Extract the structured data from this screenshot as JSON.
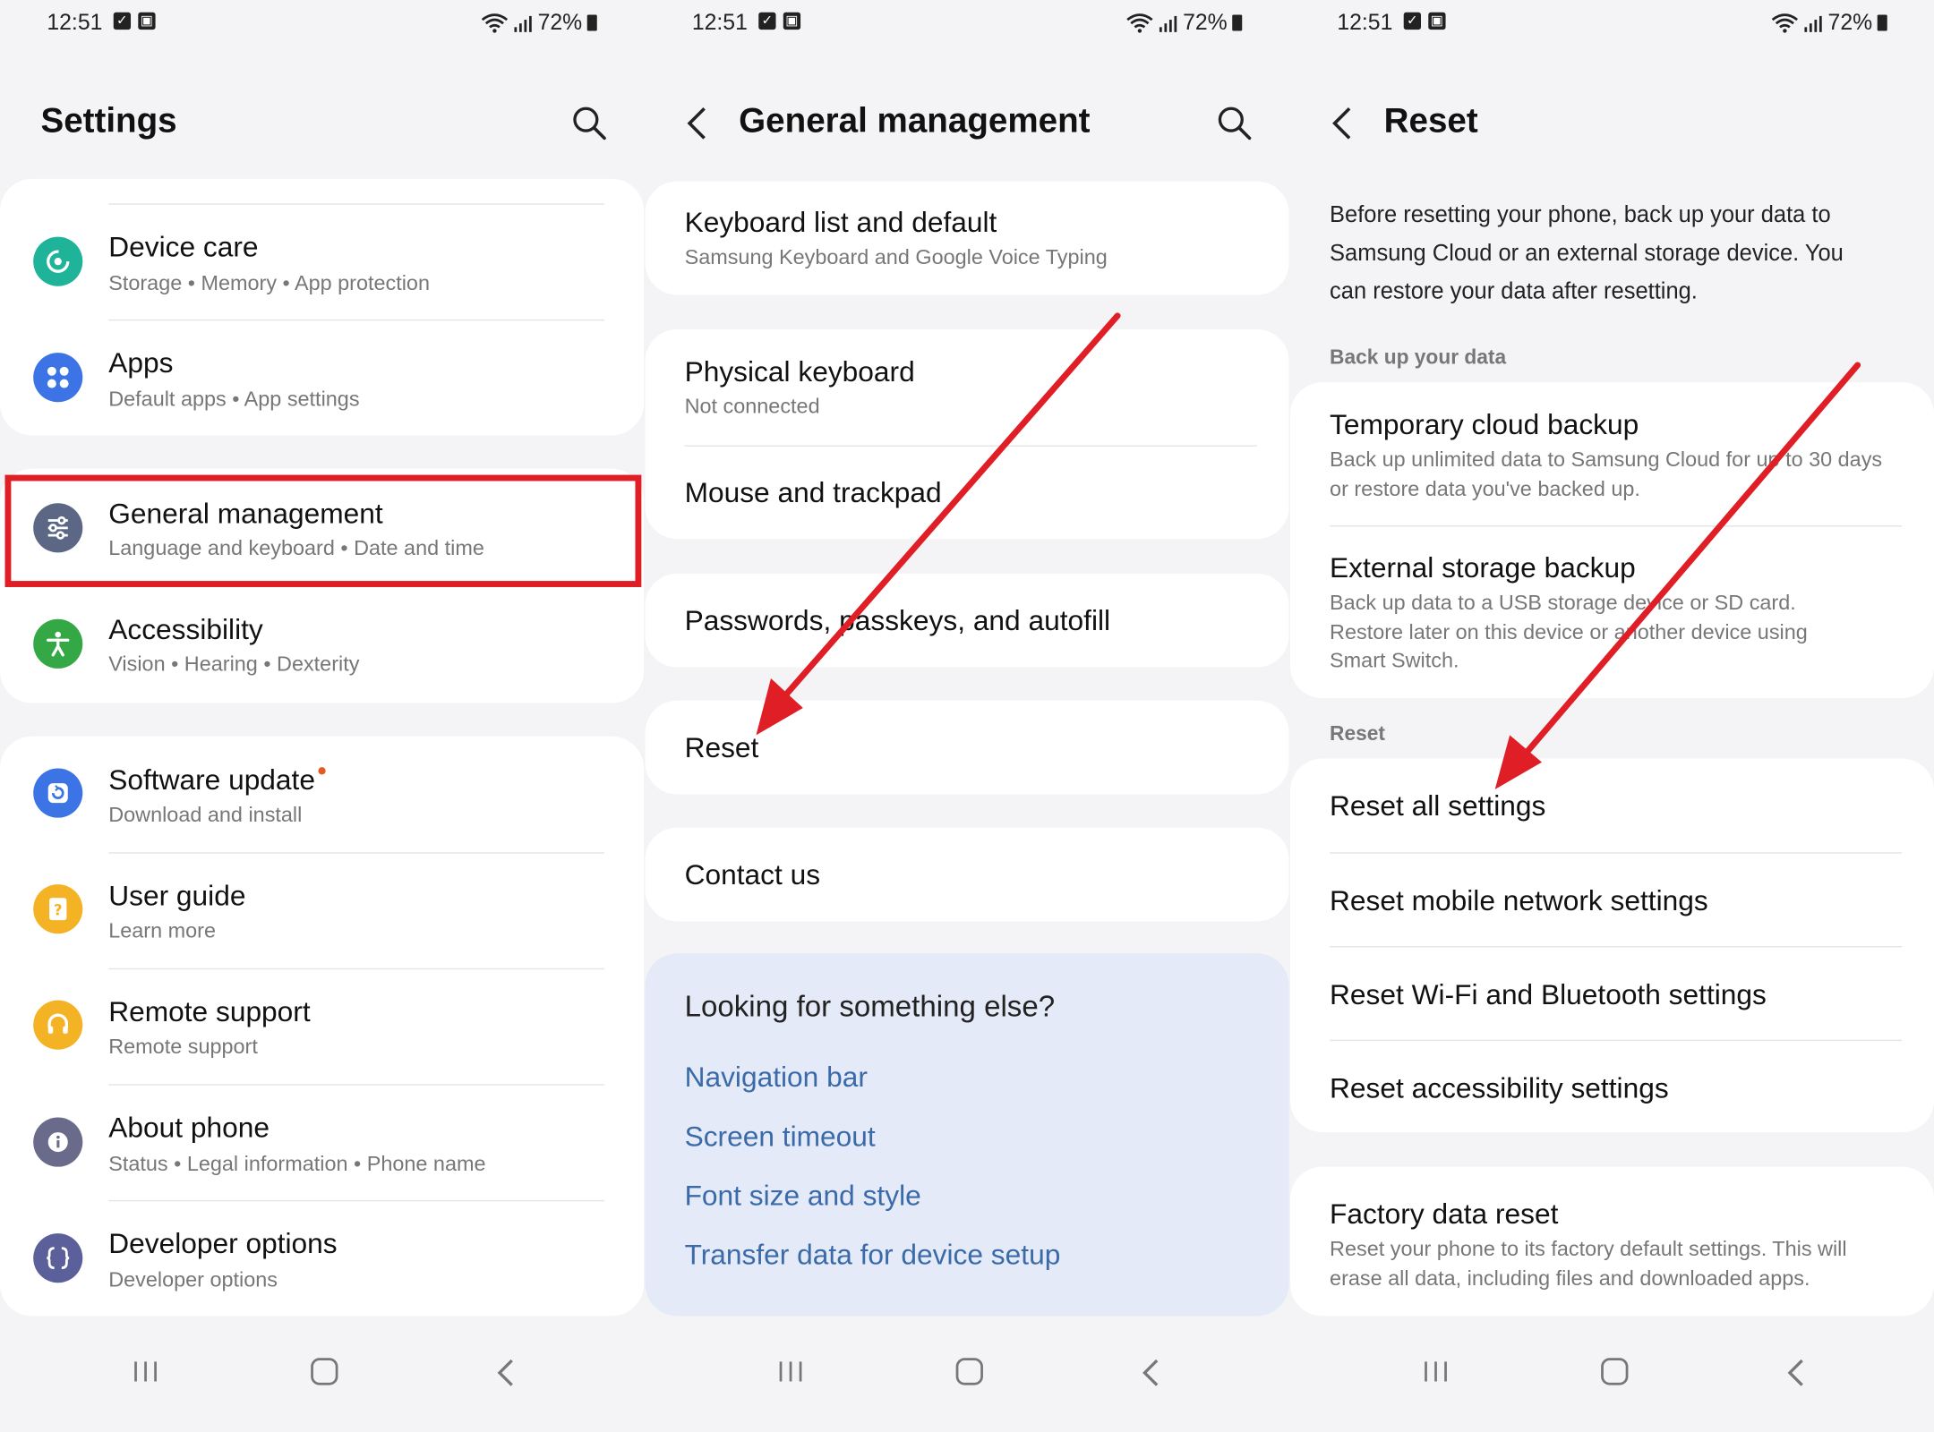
{
  "status": {
    "time": "12:51",
    "battery": "72%"
  },
  "panel1": {
    "title": "Settings",
    "items": [
      {
        "title": "Device care",
        "subtitle": "Storage  •  Memory  •  App protection",
        "color": "#1fb39a"
      },
      {
        "title": "Apps",
        "subtitle": "Default apps  •  App settings",
        "color": "#3c74e6"
      },
      {
        "title": "General management",
        "subtitle": "Language and keyboard  •  Date and time",
        "color": "#5b6784"
      },
      {
        "title": "Accessibility",
        "subtitle": "Vision  •  Hearing  •  Dexterity",
        "color": "#34a845"
      },
      {
        "title": "Software update",
        "subtitle": "Download and install",
        "color": "#3c74e6"
      },
      {
        "title": "User guide",
        "subtitle": "Learn more",
        "color": "#f4b325"
      },
      {
        "title": "Remote support",
        "subtitle": "Remote support",
        "color": "#f4b325"
      },
      {
        "title": "About phone",
        "subtitle": "Status  •  Legal information  •  Phone name",
        "color": "#6a6a8a"
      },
      {
        "title": "Developer options",
        "subtitle": "Developer options",
        "color": "#5b5f9a"
      }
    ]
  },
  "panel2": {
    "title": "General management",
    "items": [
      {
        "title": "Keyboard list and default",
        "subtitle": "Samsung Keyboard and Google Voice Typing"
      },
      {
        "title": "Physical keyboard",
        "subtitle": "Not connected"
      },
      {
        "title": "Mouse and trackpad"
      },
      {
        "title": "Passwords, passkeys, and autofill"
      },
      {
        "title": "Reset"
      },
      {
        "title": "Contact us"
      }
    ],
    "looking": {
      "title": "Looking for something else?",
      "links": [
        "Navigation bar",
        "Screen timeout",
        "Font size and style",
        "Transfer data for device setup"
      ]
    }
  },
  "panel3": {
    "title": "Reset",
    "description": "Before resetting your phone, back up your data to Samsung Cloud or an external storage device. You can restore your data after resetting.",
    "backup_label": "Back up your data",
    "backup_items": [
      {
        "title": "Temporary cloud backup",
        "subtitle": "Back up unlimited data to Samsung Cloud for up to 30 days or restore data you've backed up."
      },
      {
        "title": "External storage backup",
        "subtitle": "Back up data to a USB storage device or SD card. Restore later on this device or another device using Smart Switch."
      }
    ],
    "reset_label": "Reset",
    "reset_items": [
      "Reset all settings",
      "Reset mobile network settings",
      "Reset Wi-Fi and Bluetooth settings",
      "Reset accessibility settings"
    ],
    "factory": {
      "title": "Factory data reset",
      "subtitle": "Reset your phone to its factory default settings. This will erase all data, including files and downloaded apps."
    }
  },
  "colors": {
    "highlight": "#e01e26",
    "arrow": "#e01e26",
    "link": "#3b6aa8"
  }
}
